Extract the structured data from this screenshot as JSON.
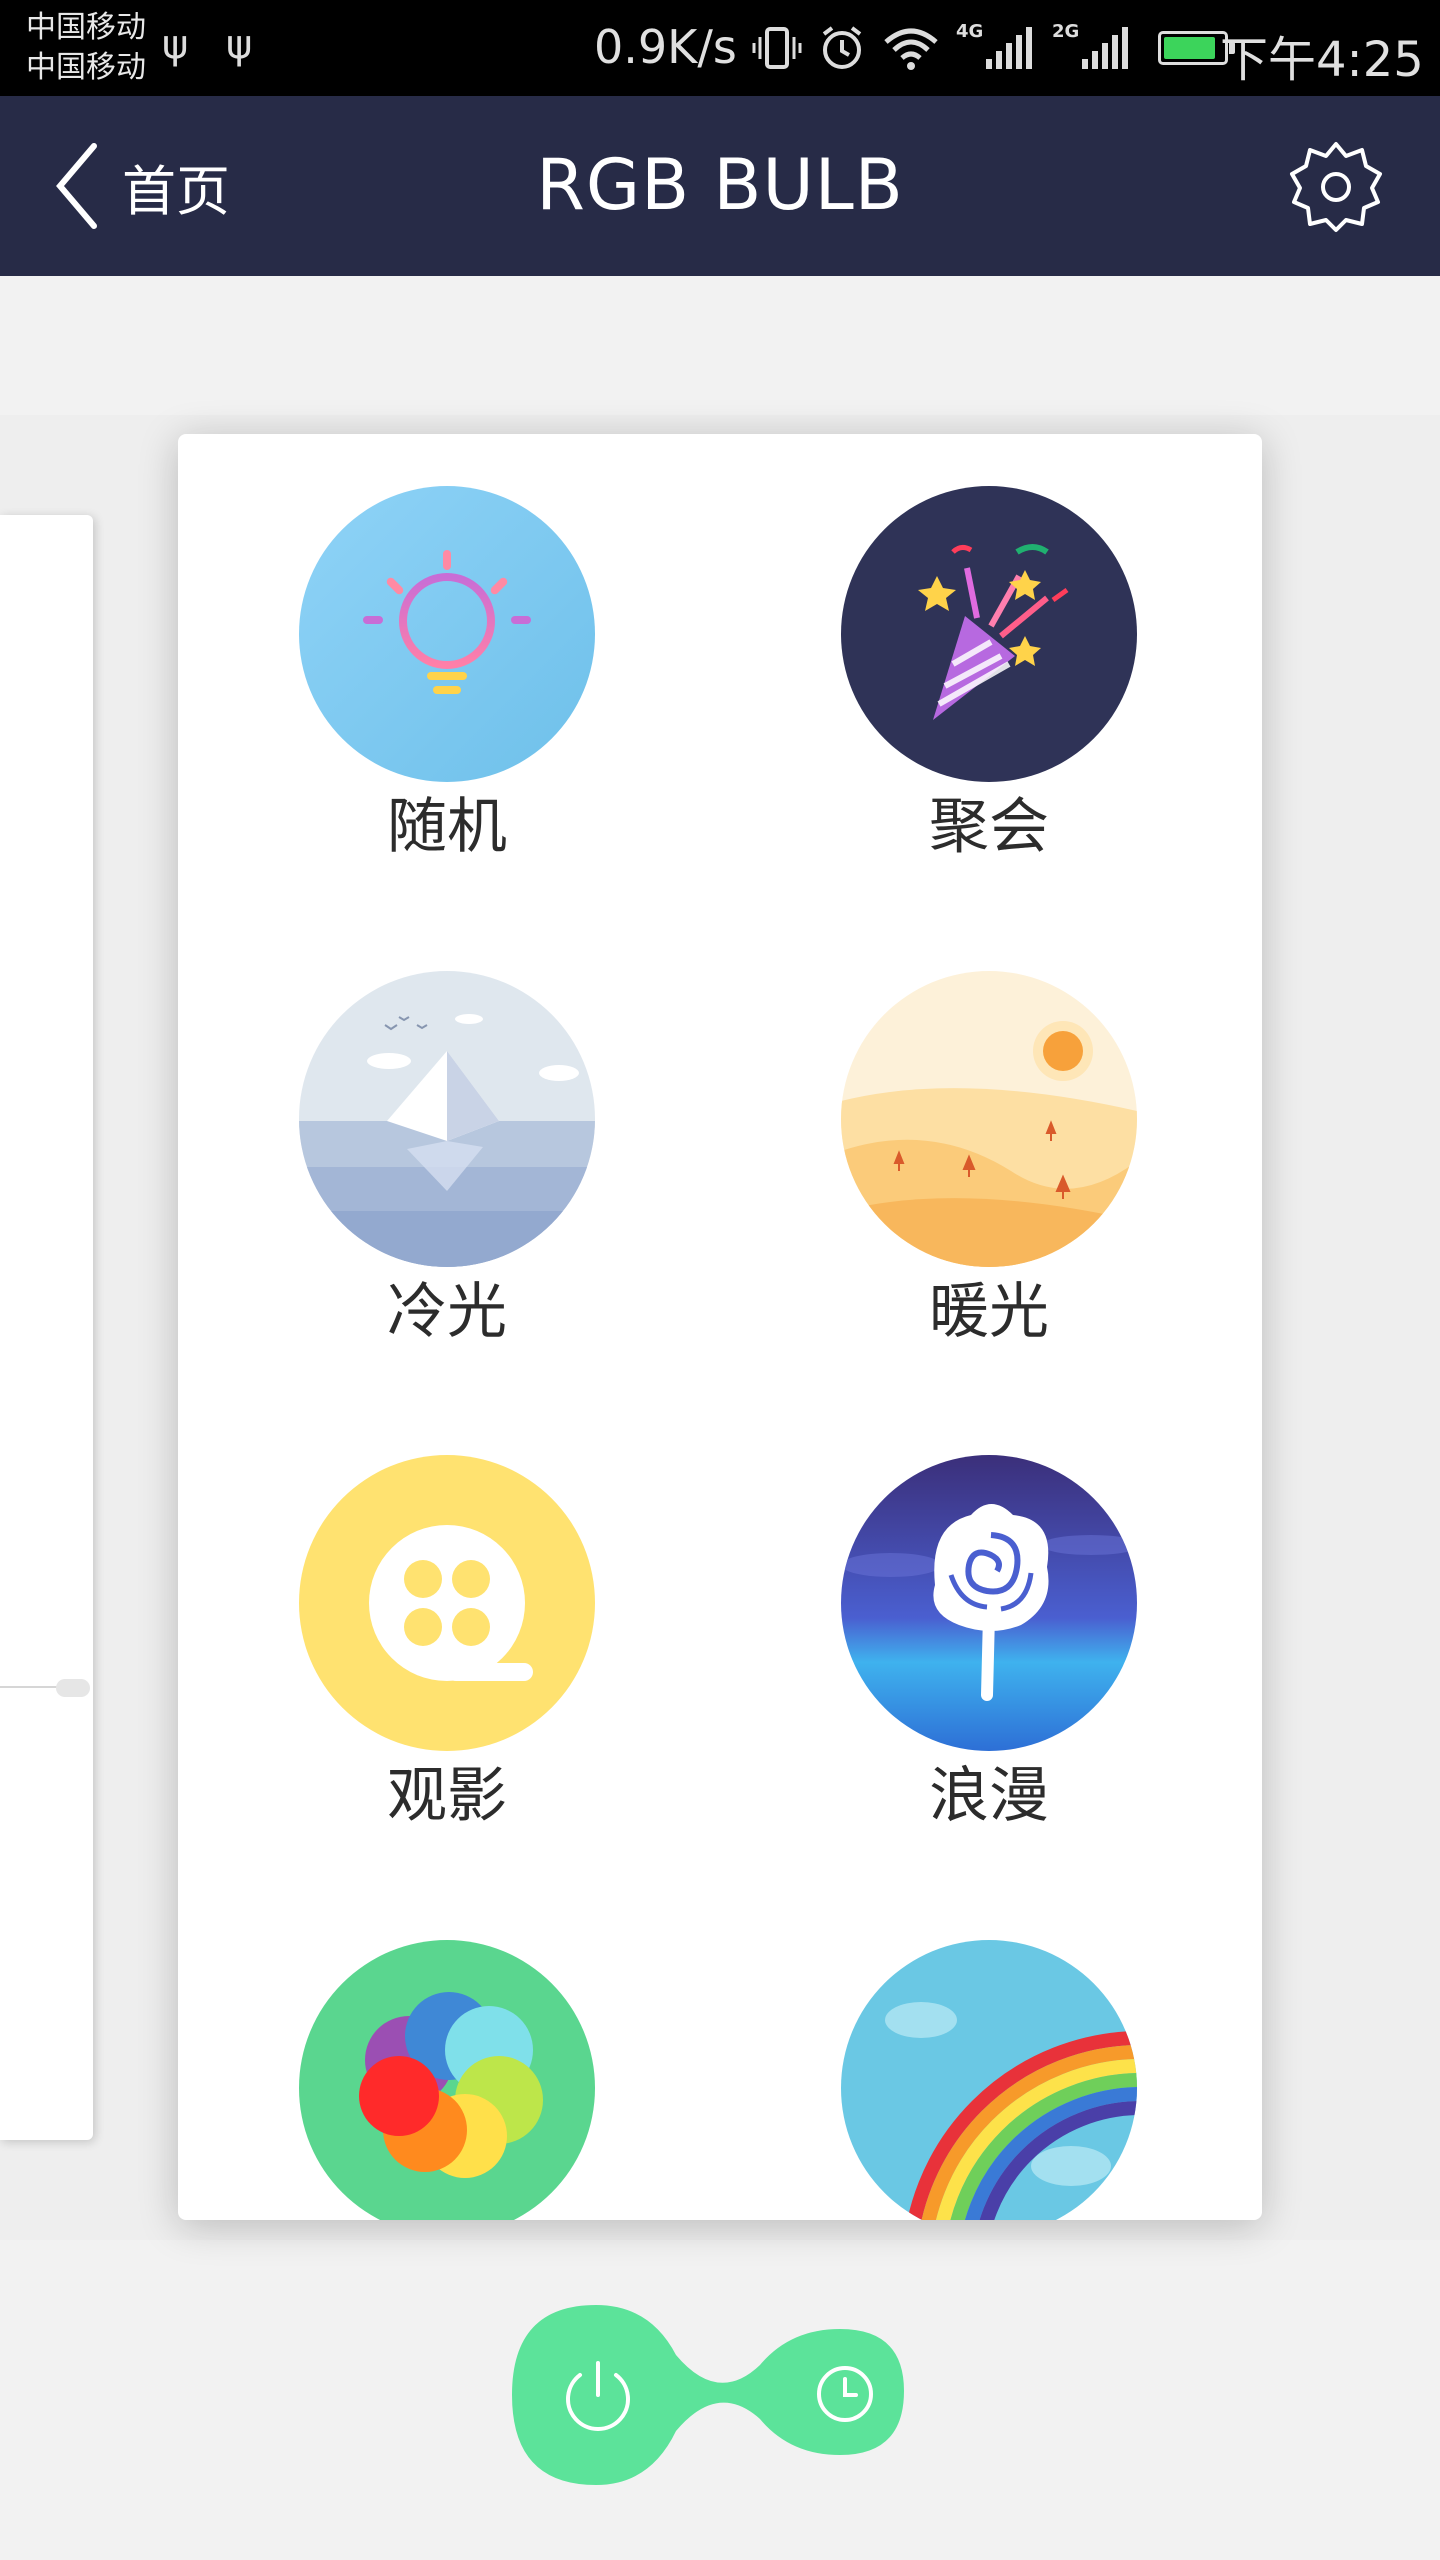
{
  "status_bar": {
    "carrier1": "中国移动",
    "carrier2": "中国移动",
    "net_speed": "0.9K/s",
    "net_tag_1": "4G",
    "net_tag_2": "2G",
    "time": "下午4:25"
  },
  "nav": {
    "back_label": "首页",
    "title": "RGB BULB"
  },
  "scenes": [
    {
      "label": "随机"
    },
    {
      "label": "聚会"
    },
    {
      "label": "冷光"
    },
    {
      "label": "暖光"
    },
    {
      "label": "观影"
    },
    {
      "label": "浪漫"
    },
    {
      "label": ""
    },
    {
      "label": ""
    }
  ],
  "colors": {
    "nav_bg": "#272b47",
    "accent_green": "#5ce39a",
    "status_bar_bg": "#000000"
  },
  "icons": {
    "random": "bulb-icon",
    "party": "party-popper-icon",
    "cool": "iceberg-icon",
    "warm": "desert-sun-icon",
    "movie": "film-reel-icon",
    "romantic": "rose-icon",
    "colorful": "color-circles-icon",
    "rainbow": "rainbow-icon",
    "power": "power-icon",
    "timer": "clock-icon",
    "settings": "gear-icon",
    "back": "chevron-left-icon"
  }
}
